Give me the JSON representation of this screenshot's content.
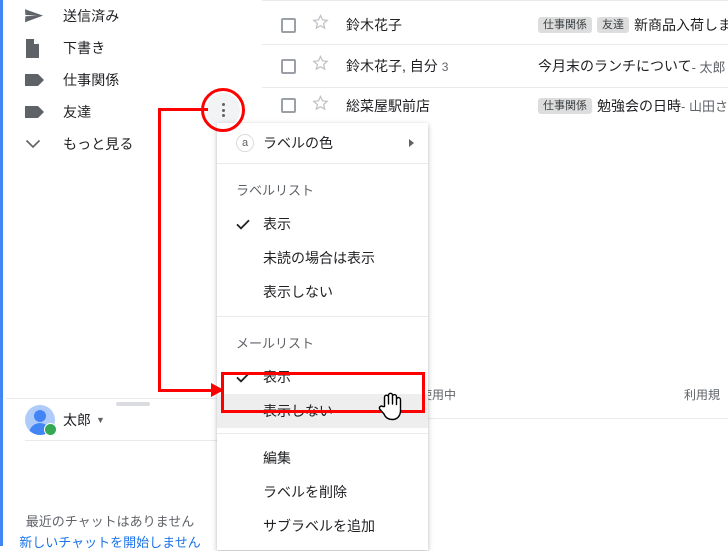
{
  "sidebar": {
    "items": [
      {
        "label": "送信済み",
        "icon": "send-icon"
      },
      {
        "label": "下書き",
        "icon": "draft-icon"
      },
      {
        "label": "仕事関係",
        "icon": "label-tag-icon"
      },
      {
        "label": "友達",
        "icon": "label-tag-icon"
      },
      {
        "label": "もっと見る",
        "icon": "chevron-down-icon"
      }
    ]
  },
  "chat": {
    "user_name": "太郎",
    "empty_text": "最近のチャットはありません",
    "start_link": "新しいチャットを開始しません"
  },
  "messages": {
    "rows": [
      {
        "sender": "鈴木花子",
        "count": "",
        "chips": [
          "仕事関係",
          "友達"
        ],
        "subject": "新商品入荷しま",
        "snippet": ""
      },
      {
        "sender": "鈴木花子, 自分",
        "count": "3",
        "chips": [],
        "subject": "今月末のランチについて",
        "snippet": " - 太郎"
      },
      {
        "sender": "総菜屋駅前店",
        "count": "",
        "chips": [
          "仕事関係"
        ],
        "subject": "勉強会の日時",
        "snippet": " - 山田さ"
      }
    ]
  },
  "footer": {
    "left_text": "使用中",
    "right_text": "利用規"
  },
  "menu": {
    "color_item": {
      "label": "ラベルの色",
      "badge": "a"
    },
    "label_list": {
      "title": "ラベルリスト",
      "options": [
        {
          "label": "表示",
          "checked": true
        },
        {
          "label": "未読の場合は表示",
          "checked": false
        },
        {
          "label": "表示しない",
          "checked": false
        }
      ]
    },
    "mail_list": {
      "title": "メールリスト",
      "options": [
        {
          "label": "表示",
          "checked": true
        },
        {
          "label": "表示しない",
          "checked": false,
          "highlighted": true
        }
      ]
    },
    "actions": [
      {
        "label": "編集"
      },
      {
        "label": "ラベルを削除"
      },
      {
        "label": "サブラベルを追加"
      }
    ]
  },
  "colors": {
    "annotation": "#ff0000",
    "accent": "#4285f4",
    "link": "#1a73e8",
    "highlight_bg": "#eeeeee"
  }
}
